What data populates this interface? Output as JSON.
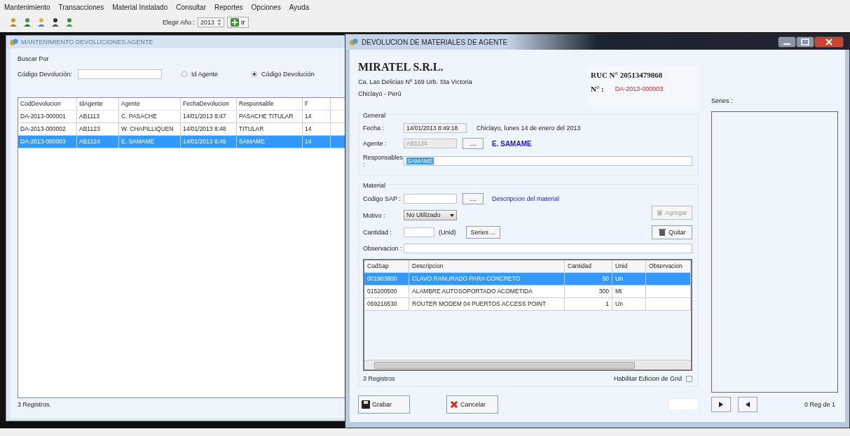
{
  "menu": [
    "Mantenimiento",
    "Transacciones",
    "Material Instalado",
    "Consultar",
    "Reportes",
    "Opciones",
    "Ayuda"
  ],
  "toolbar": {
    "year_label": "Elegir Año :",
    "year_value": "2013",
    "go_button": "Ir"
  },
  "back_window": {
    "title": "MANTENIMIENTO DEVOLUCIONES AGENTE",
    "search": {
      "group_label": "Buscar Por",
      "field_label": "Código Devolución:",
      "radios": [
        {
          "label": "Id Agente",
          "selected": false
        },
        {
          "label": "Código Devolución",
          "selected": true
        }
      ]
    },
    "table": {
      "columns": [
        "CodDevolucion",
        "IdAgente",
        "Agente",
        "FechaDevolucion",
        "Responsable",
        "F"
      ],
      "rows": [
        {
          "cells": [
            "DA-2013-000001",
            "AB1113",
            "C. PASACHE",
            "14/01/2013 8:47",
            "PASACHE TITULAR",
            "14"
          ],
          "selected": false
        },
        {
          "cells": [
            "DA-2013-000002",
            "AB1123",
            "W. CHAPILLIQUEN",
            "14/01/2013 8:48",
            "TITULAR",
            "14"
          ],
          "selected": false
        },
        {
          "cells": [
            "DA-2013-000003",
            "AB1124",
            "E. SAMAME",
            "14/01/2013 8:49",
            "SAMAME",
            "14"
          ],
          "selected": true
        }
      ]
    },
    "status": "3 Registros."
  },
  "dialog": {
    "title": "DEVOLUCION DE MATERIALES DE AGENTE",
    "company": {
      "name": "MIRATEL S.R.L.",
      "address": "Ca. Las Delicias Nº 169 Urb. Sta Victoria",
      "city": "Chiclayo - Perú"
    },
    "ruc": "RUC N° 20513479868",
    "number_label": "N° :",
    "number": "DA-2013-000003",
    "general": {
      "legend": "General",
      "fecha_label": "Fecha :",
      "fecha_value": "14/01/2013 8:49:18",
      "fecha_text": "Chiclayo,  lunes 14 de  enero del  2013",
      "agente_label": "Agente :",
      "agente_value": "AB1124",
      "agente_disabled": true,
      "browse": "....",
      "agente_name": "E. SAMAME",
      "responsables_label": "Responsables :",
      "responsables_value": "SAMAME"
    },
    "material": {
      "legend": "Material",
      "codigo_label": "Codigo SAP :",
      "browse": "....",
      "descripcion": "Descripcion del material",
      "motivo_label": "Motivo :",
      "motivo_value": "No Utilizado",
      "cantidad_label": "Cantidad :",
      "unid": "(Unid)",
      "series_button": "Series ...",
      "observacion_label": "Observacion :",
      "buttons": [
        {
          "label": "Agregar",
          "disabled": true
        },
        {
          "label": "Quitar",
          "disabled": false
        }
      ]
    },
    "grid": {
      "columns": [
        "CodSap",
        "Descripcion",
        "Cantidad",
        "Unid",
        "Observacion"
      ],
      "rows": [
        {
          "cells": [
            "001903800",
            "CLAVO RANURADO PARA CONCRETO",
            "50",
            "Un",
            ""
          ],
          "selected": true
        },
        {
          "cells": [
            "015200500",
            "ALAMBRE AUTOSOPORTADO ACOMETIDA",
            "300",
            "Mt",
            ""
          ],
          "selected": false
        },
        {
          "cells": [
            "069216530",
            "ROUTER MODEM 04 PUERTOS ACCESS POINT",
            "1",
            "Un",
            ""
          ],
          "selected": false
        }
      ]
    },
    "count": "3 Registros",
    "edit_grid": {
      "label": "Habilitar Edicion de Grid",
      "checked": false
    },
    "save_button": "Grabar",
    "cancel_button": "Cancelar",
    "series": {
      "label": "Series :",
      "pager_text": "0 Reg de 1"
    }
  }
}
